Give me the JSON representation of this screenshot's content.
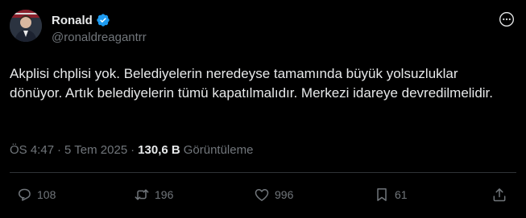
{
  "user": {
    "display_name": "Ronald",
    "handle": "@ronaldreagantrr",
    "verified": true
  },
  "tweet": {
    "text": "Akplisi chplisi yok. Belediyelerin neredeyse tamamında büyük yolsuzluklar dönüyor. Artık belediyelerin tümü kapatılmalıdır. Merkezi idareye devredilmelidir."
  },
  "meta": {
    "time": "ÖS 4:47",
    "separator": "·",
    "date": "5 Tem 2025",
    "views_count": "130,6 B",
    "views_label": "Görüntüleme"
  },
  "actions": {
    "replies": "108",
    "reposts": "196",
    "likes": "996",
    "bookmarks": "61"
  },
  "colors": {
    "background": "#000000",
    "text": "#e7e9ea",
    "secondary": "#71767b",
    "verified": "#1d9bf0",
    "divider": "#2f3336"
  },
  "icons": [
    "verified-badge-icon",
    "more-icon",
    "reply-icon",
    "retweet-icon",
    "like-icon",
    "bookmark-icon",
    "share-icon"
  ]
}
